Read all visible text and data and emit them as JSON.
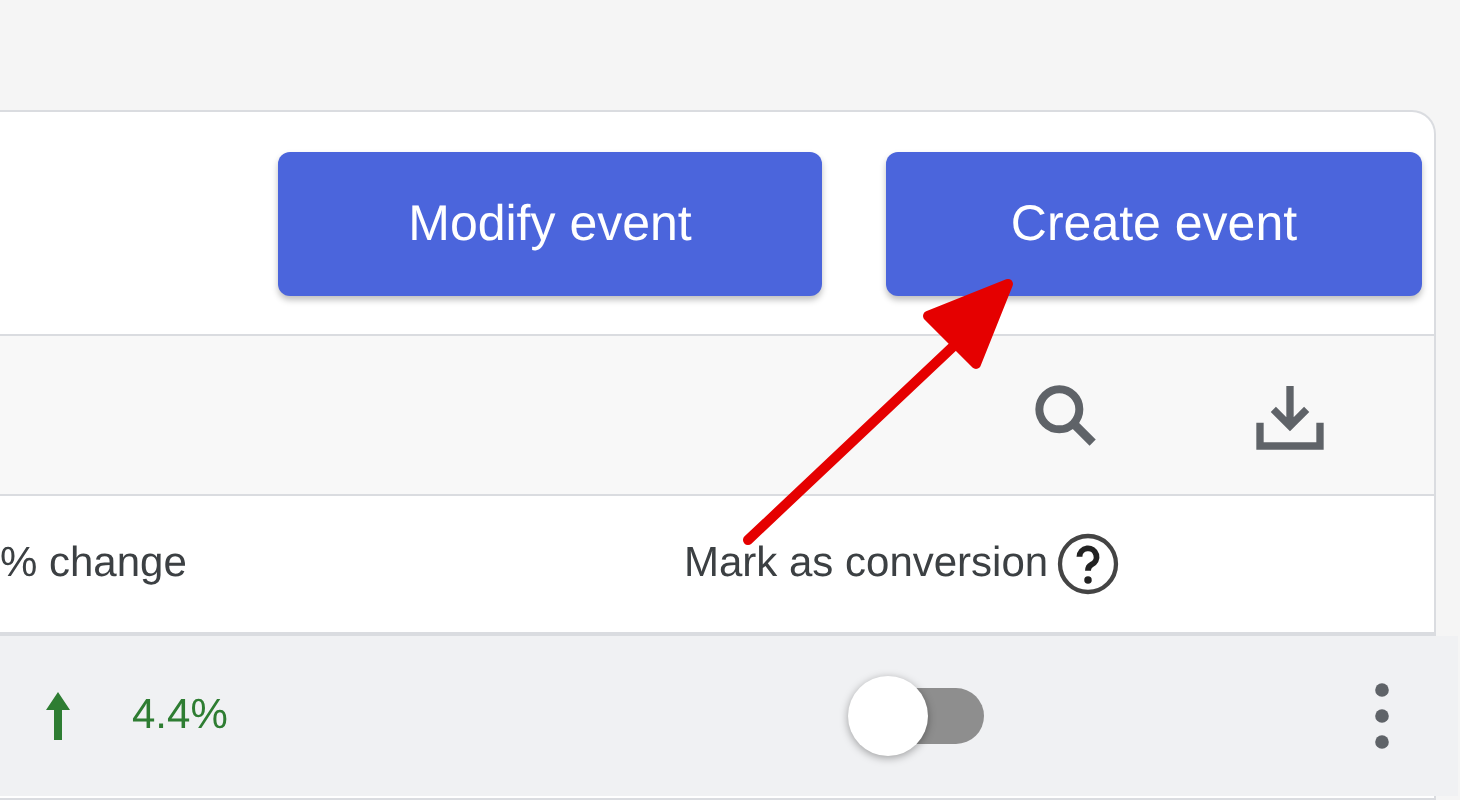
{
  "actions": [
    {
      "label": "Modify event"
    },
    {
      "label": "Create event"
    }
  ],
  "table": {
    "columns": [
      {
        "label": "% change",
        "help": false
      },
      {
        "label": "Mark as conversion",
        "help": true
      }
    ],
    "rows": [
      {
        "change": "4.4%",
        "conversion": false
      }
    ]
  }
}
